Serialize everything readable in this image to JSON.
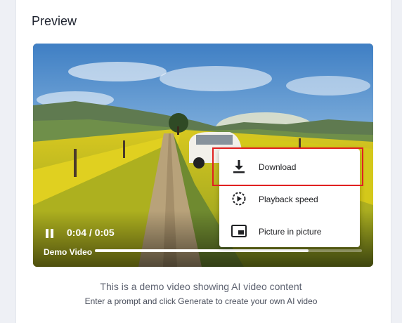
{
  "preview": {
    "title": "Preview"
  },
  "player": {
    "time": "0:04 / 0:05",
    "caption": "Demo Video",
    "progress_fraction": 0.8,
    "play_icon": "pause-icon"
  },
  "menu": {
    "items": [
      {
        "label": "Download",
        "icon": "download-icon"
      },
      {
        "label": "Playback speed",
        "icon": "playback-speed-icon"
      },
      {
        "label": "Picture in picture",
        "icon": "picture-in-picture-icon"
      }
    ],
    "highlight_color": "#e02020"
  },
  "description": {
    "line1": "This is a demo video showing AI video content",
    "line2": "Enter a prompt and click Generate to create your own AI video"
  }
}
